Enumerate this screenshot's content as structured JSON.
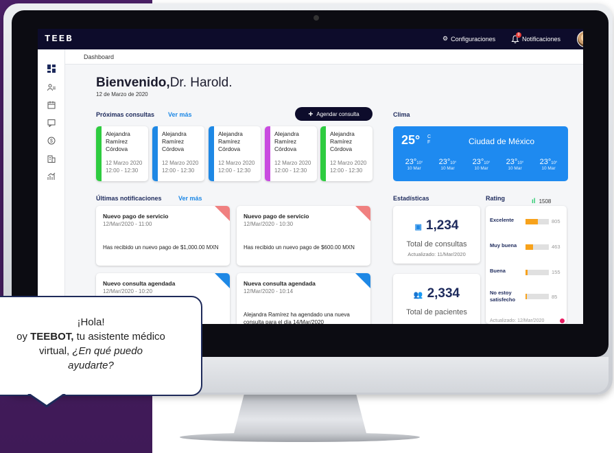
{
  "app": {
    "logo": "TEEB"
  },
  "topbar": {
    "config_label": "Configuraciones",
    "notif_label": "Notificaciones",
    "notif_count": "8"
  },
  "breadcrumb": "Dashboard",
  "welcome": {
    "greeting": "Bienvenido,",
    "name": "Dr. Harold.",
    "date": "12 de Marzo de 2020"
  },
  "appointments": {
    "title": "Próximas consultas",
    "see_more": "Ver más",
    "add_button": "Agendar consulta",
    "items": [
      {
        "name": "Alejandra Ramírez Córdova",
        "date": "12 Marzo 2020",
        "time": "12:00 - 12:30",
        "color": "#2ecc40"
      },
      {
        "name": "Alejandra Ramírez Córdova",
        "date": "12 Marzo 2020",
        "time": "12:00 - 12:30",
        "color": "#1e88e5"
      },
      {
        "name": "Alejandra Ramírez Córdova",
        "date": "12 Marzo 2020",
        "time": "12:00 - 12:30",
        "color": "#1e88e5"
      },
      {
        "name": "Alejandra Ramírez Córdova",
        "date": "12 Marzo 2020",
        "time": "12:00 - 12:30",
        "color": "#c94ce0"
      },
      {
        "name": "Alejandra Ramírez Córdova",
        "date": "12 Marzo 2020",
        "time": "12:00 - 12:30",
        "color": "#2ecc40"
      }
    ]
  },
  "weather": {
    "title": "Clima",
    "temp": "25°",
    "unit_c": "C",
    "unit_f": "F",
    "city": "Ciudad de México",
    "forecast": [
      {
        "temp": "23°",
        "low": "10°",
        "day": "10 Mar"
      },
      {
        "temp": "23°",
        "low": "10°",
        "day": "10 Mar"
      },
      {
        "temp": "23°",
        "low": "10°",
        "day": "10 Mar"
      },
      {
        "temp": "23°",
        "low": "10°",
        "day": "10 Mar"
      },
      {
        "temp": "23°",
        "low": "10°",
        "day": "10 Mar"
      }
    ]
  },
  "notifications": {
    "title": "Últimas notificaciones",
    "see_more": "Ver más",
    "items": [
      {
        "title": "Nuevo pago de servicio",
        "date": "12/Mar/2020 - 11:00",
        "body": "Has recibido un nuevo pago de $1,000.00 MXN",
        "corner": "red"
      },
      {
        "title": "Nuevo pago de servicio",
        "date": "12/Mar/2020 - 10:30",
        "body": "Has recibido un nuevo pago de $600.00 MXN",
        "corner": "red"
      },
      {
        "title": "Nuevo consulta agendada",
        "date": "12/Mar/2020 - 10:20",
        "body": "",
        "corner": "blue"
      },
      {
        "title": "Nueva consulta agendada",
        "date": "12/Mar/2020 - 10:14",
        "body": "Alejandra Ramírez ha agendado una nueva consulta para el día 14/Mar/2020",
        "corner": "blue"
      }
    ]
  },
  "stats": {
    "title": "Estadísticas",
    "consultas": {
      "value": "1,234",
      "label": "Total de consultas",
      "updated": "Actualizado: 11/Mar/2020"
    },
    "pacientes": {
      "value": "2,334",
      "label": "Total de pacientes"
    }
  },
  "rating": {
    "title": "Rating",
    "total": "1508",
    "items": [
      {
        "label": "Excelente",
        "value": "805",
        "fraction": 0.53
      },
      {
        "label": "Muy buena",
        "value": "463",
        "fraction": 0.31
      },
      {
        "label": "Buena",
        "value": "155",
        "fraction": 0.1
      },
      {
        "label": "No estoy satisfecho",
        "value": "85",
        "fraction": 0.06
      }
    ],
    "updated": "Actualizado: 12/Mar/2020"
  },
  "bubble": {
    "line1": "¡Hola!",
    "line2_prefix": "oy ",
    "bot_name": "TEEBOT,",
    "line2_suffix": " tu asistente médico",
    "line3": "virtual, ",
    "question_a": "¿En qué puedo",
    "question_b": "ayudarte?"
  },
  "colors": {
    "accent": "#1e88e5",
    "navy": "#0d0c2b",
    "background_purple": "#4a1e63"
  }
}
